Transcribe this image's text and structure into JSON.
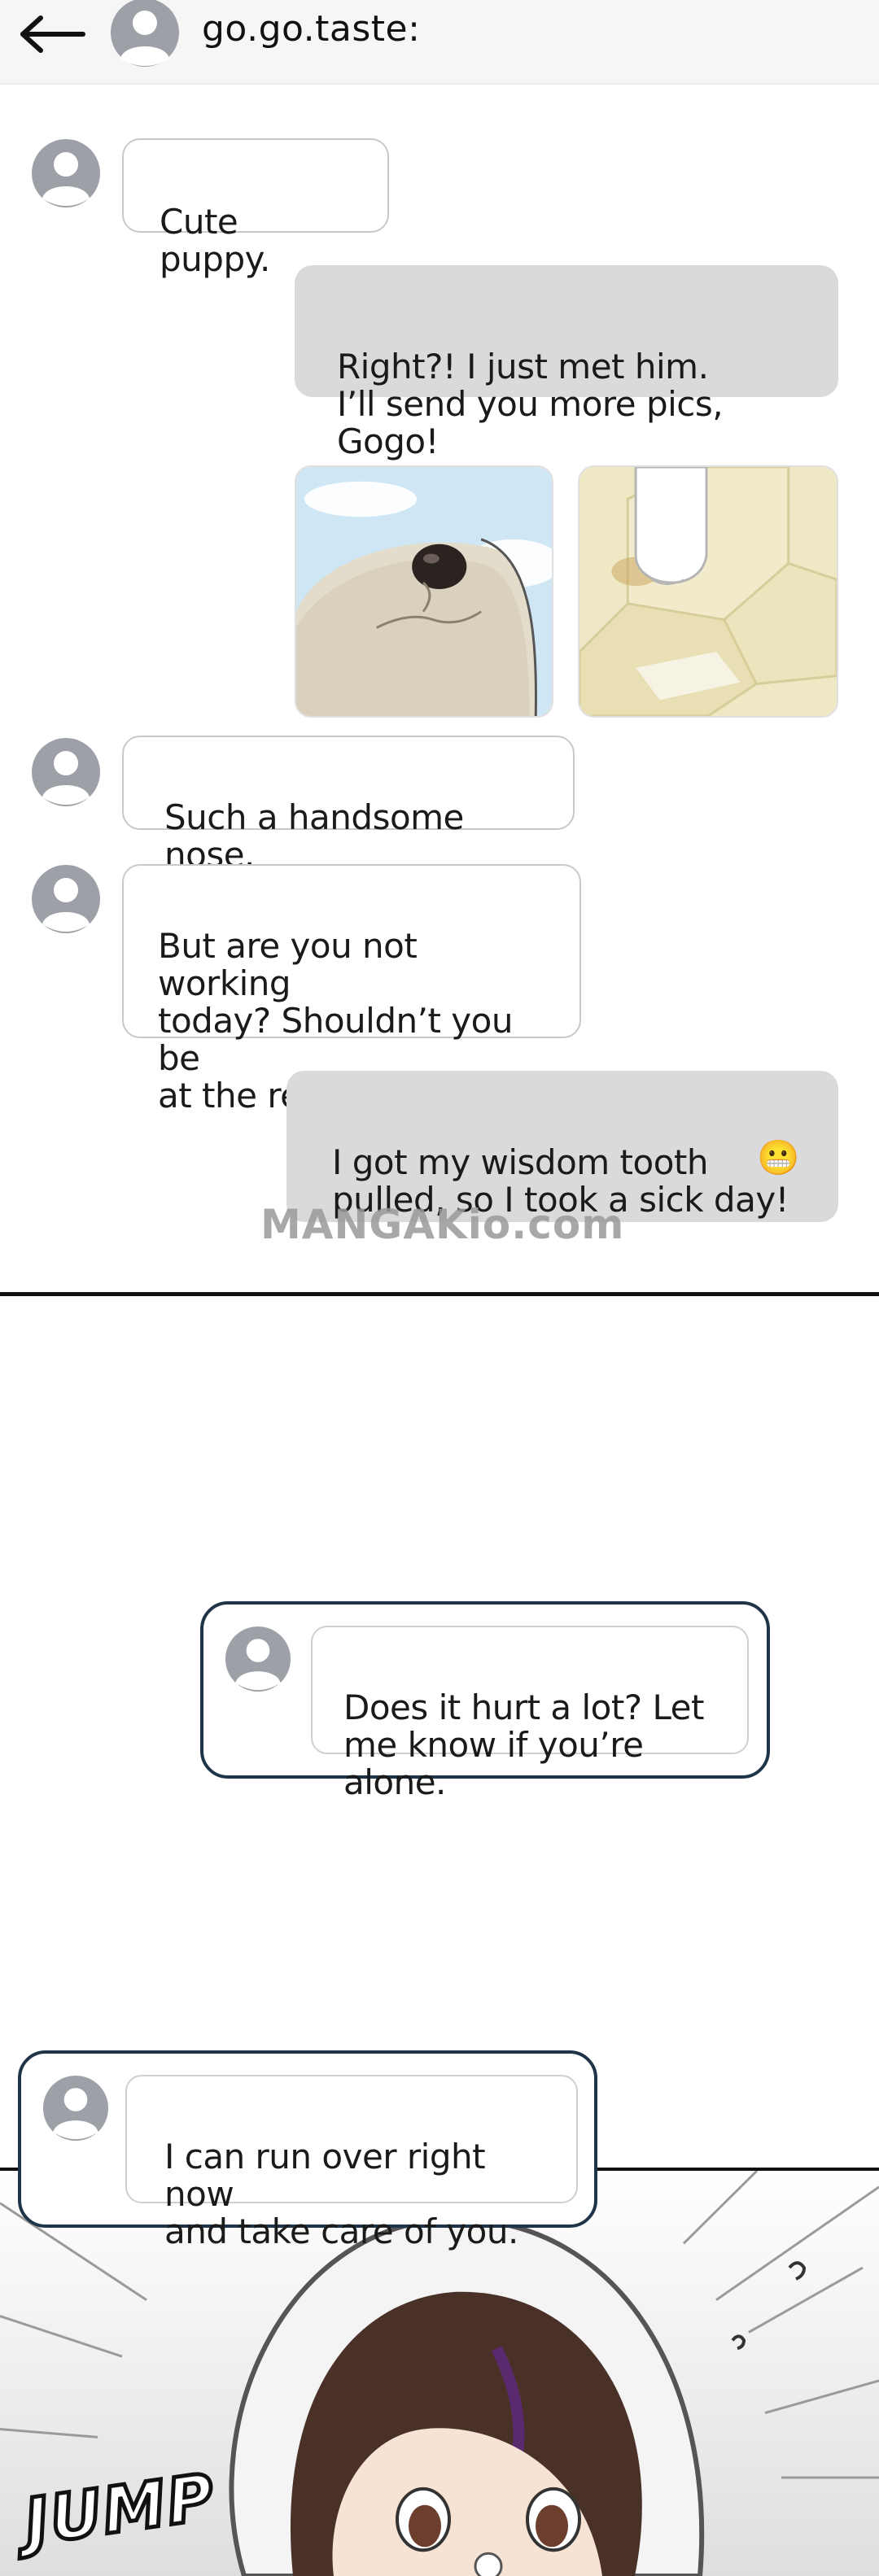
{
  "header": {
    "contact_name": "go.go.taste:",
    "back_icon": "arrow-left-icon",
    "avatar_icon": "default-avatar-icon"
  },
  "messages": [
    {
      "direction": "incoming",
      "text": "Cute puppy."
    },
    {
      "direction": "outgoing",
      "text": "Right?! I just met him.\nI’ll send you more pics, Gogo!"
    },
    {
      "direction": "outgoing",
      "type": "photos",
      "photos": [
        "dog-nose-photo",
        "dog-paw-photo"
      ]
    },
    {
      "direction": "incoming",
      "text": "Such a handsome nose."
    },
    {
      "direction": "incoming",
      "text": "But are you not working\ntoday? Shouldn’t you be\nat the restaurant?"
    },
    {
      "direction": "outgoing",
      "text": "I got my wisdom tooth\npulled, so I took a sick day!",
      "emoji": "😬"
    }
  ],
  "watermark": "MANGAKio.com",
  "notifications": [
    {
      "text": "Does it hurt a lot? Let\nme know if you’re alone."
    },
    {
      "text": "I can run over right now\nand take care of you."
    }
  ],
  "sfx": "JUMP",
  "colors": {
    "header_bg": "#f6f6f7",
    "outgoing_bubble": "#d9dadb",
    "incoming_border": "#c9c9c9",
    "notification_border": "#1f3448"
  }
}
